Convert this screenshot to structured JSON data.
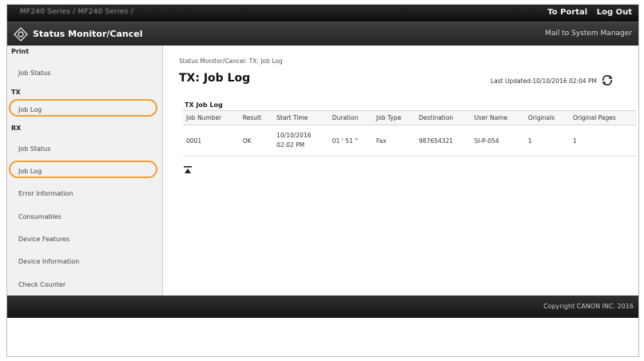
{
  "topbar": {
    "model": "MF240 Series / MF240 Series /",
    "portal": "To Portal",
    "logout": "Log Out"
  },
  "header": {
    "title": "Status Monitor/Cancel",
    "mail": "Mail to System Manager"
  },
  "sidebar": {
    "print_label": "Print",
    "print_job_status": "Job Status",
    "tx_label": "TX",
    "tx_job_log": "Job Log",
    "rx_label": "RX",
    "rx_job_status": "Job Status",
    "rx_job_log": "Job Log",
    "error_information": "Error Information",
    "consumables": "Consumables",
    "device_features": "Device Features",
    "device_information": "Device Information",
    "check_counter": "Check Counter"
  },
  "main": {
    "breadcrumb": "Status Monitor/Cancel: TX: Job Log",
    "title": "TX: Job Log",
    "last_updated": "Last Updated:10/10/2016 02:04 PM",
    "table_title": "TX Job Log",
    "columns": [
      "Job Number",
      "Result",
      "Start Time",
      "Duration",
      "Job Type",
      "Destination",
      "User Name",
      "Originals",
      "Original Pages"
    ],
    "rows": [
      {
        "job_number": "0001",
        "result": "OK",
        "start_time_date": "10/10/2016",
        "start_time_clock": "02:02 PM",
        "duration": "01 ' 51 \"",
        "job_type": "Fax",
        "destination": "987654321",
        "user_name": "SI-P-054",
        "originals": "1",
        "original_pages": "1"
      }
    ]
  },
  "footer": {
    "copyright": "Copyright CANON INC. 2016"
  },
  "colors": {
    "highlight": "#f0a032",
    "sidebar_bg": "#f1f1f1",
    "header_bg": "#262626"
  }
}
